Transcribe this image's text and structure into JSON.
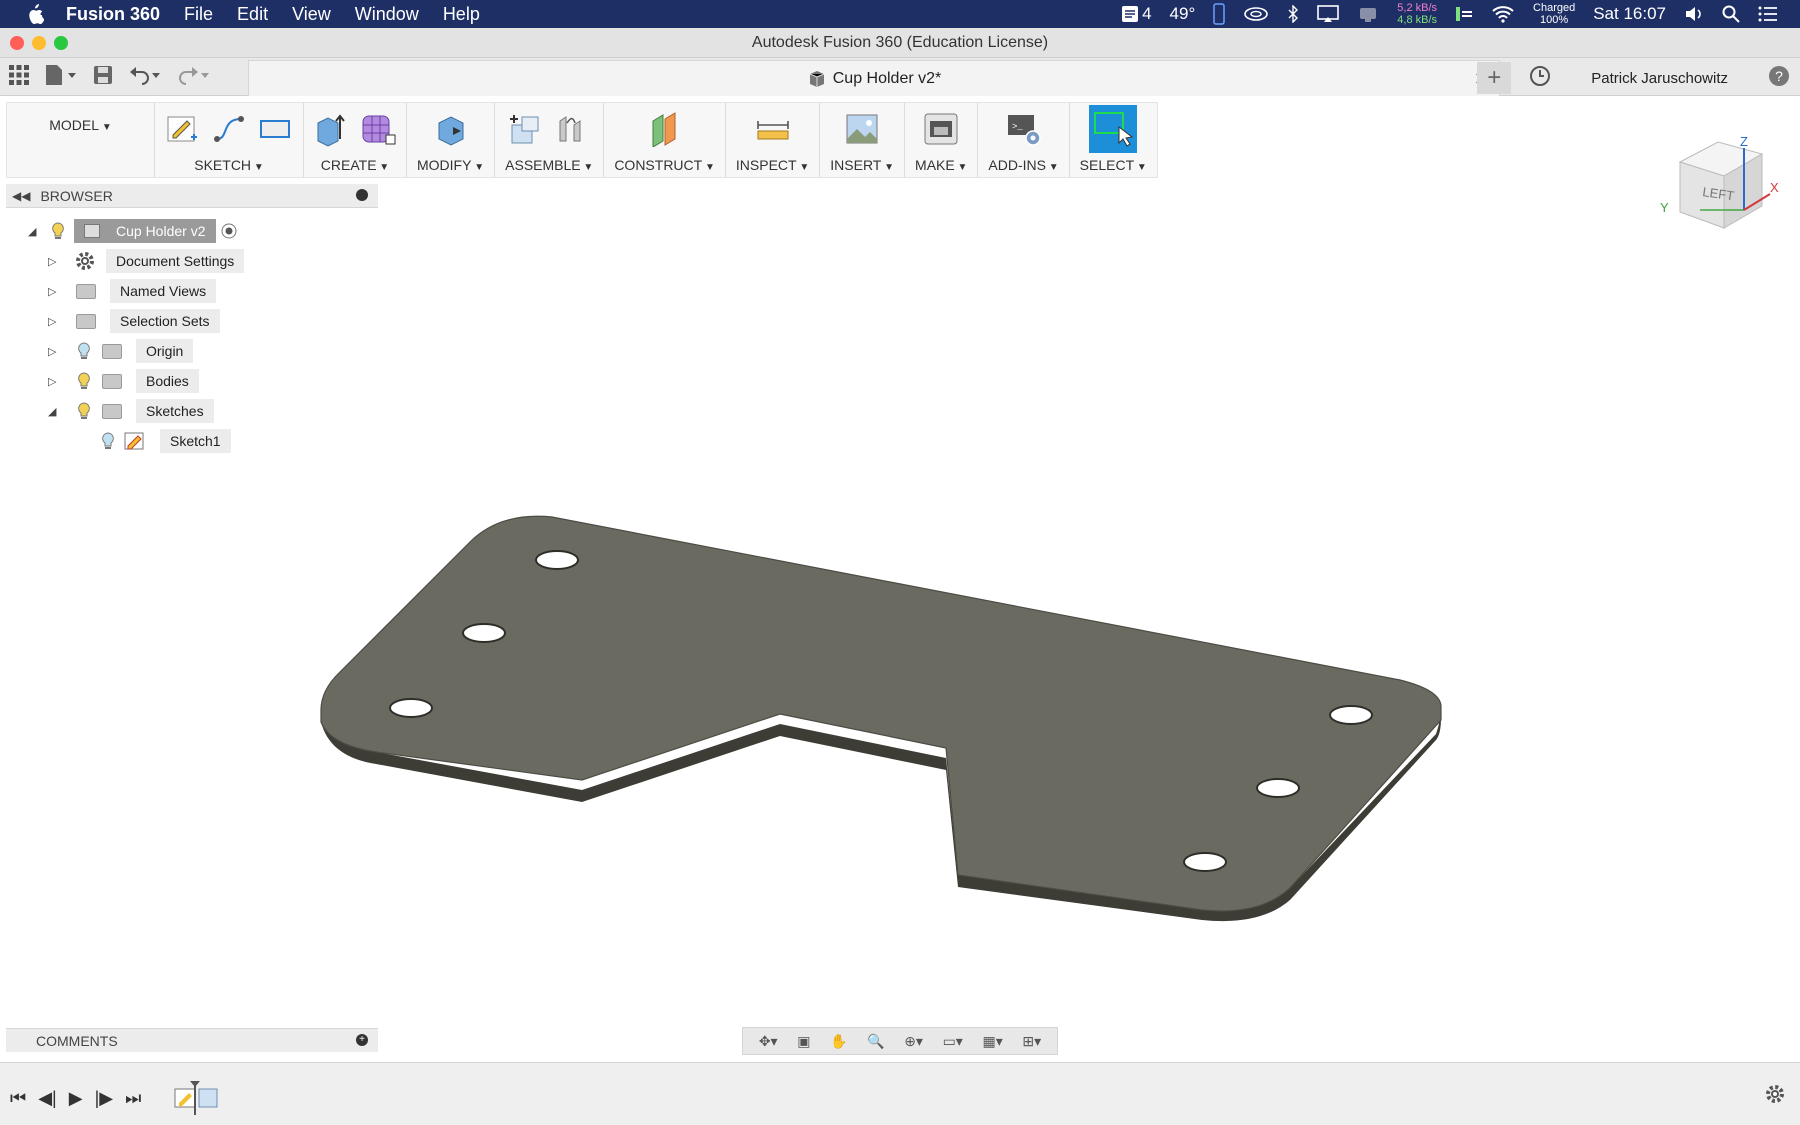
{
  "menubar": {
    "app_name": "Fusion 360",
    "items": [
      "File",
      "Edit",
      "View",
      "Window",
      "Help"
    ],
    "status": {
      "notif_count": "4",
      "temperature": "49°",
      "net_up": "5,2 kB/s",
      "net_down": "4,8 kB/s",
      "battery_line1": "Charged",
      "battery_line2": "100%",
      "clock": "Sat 16:07"
    }
  },
  "window": {
    "title": "Autodesk Fusion 360 (Education License)"
  },
  "appbar": {
    "doc_tab": "Cup Holder v2*",
    "user": "Patrick Jaruschowitz"
  },
  "ribbon": {
    "workspace": "MODEL",
    "groups": [
      "SKETCH",
      "CREATE",
      "MODIFY",
      "ASSEMBLE",
      "CONSTRUCT",
      "INSPECT",
      "INSERT",
      "MAKE",
      "ADD-INS",
      "SELECT"
    ]
  },
  "browser": {
    "header": "BROWSER",
    "root": "Cup Holder v2",
    "items": [
      "Document Settings",
      "Named Views",
      "Selection Sets",
      "Origin",
      "Bodies",
      "Sketches",
      "Sketch1"
    ]
  },
  "comments": {
    "header": "COMMENTS"
  },
  "viewcube": {
    "face": "LEFT",
    "axis_z": "Z",
    "axis_x": "X",
    "axis_y": "Y"
  },
  "colors": {
    "menubar": "#1e2f66",
    "select_active": "#1d8ed8",
    "part_body": "#6b6a60",
    "part_edge": "#3d3d36"
  },
  "icons": [
    "apple-icon",
    "grid-icon",
    "file-icon",
    "save-icon",
    "undo-icon",
    "redo-icon",
    "close-icon",
    "plus-icon",
    "clock-icon",
    "help-icon",
    "settings-icon"
  ]
}
